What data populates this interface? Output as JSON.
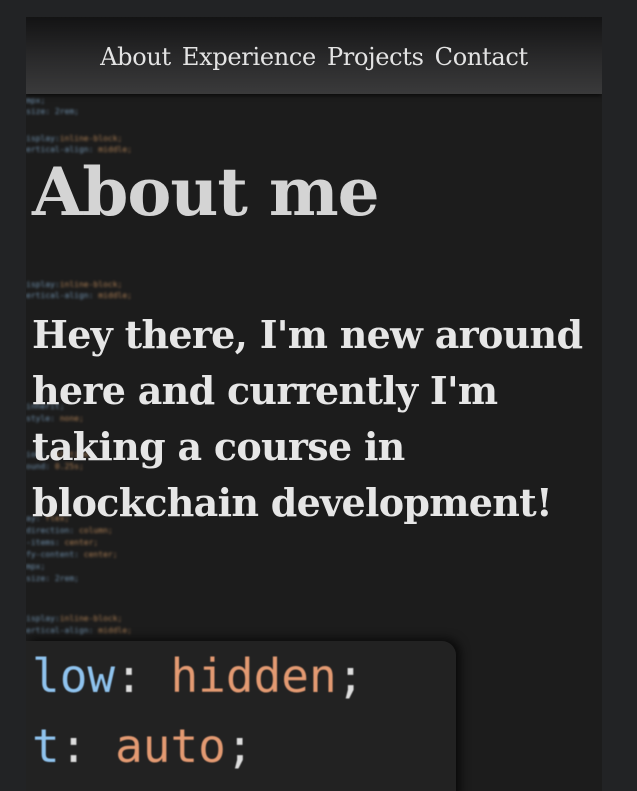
{
  "nav": {
    "items": [
      {
        "label": "About"
      },
      {
        "label": "Experience"
      },
      {
        "label": "Projects"
      },
      {
        "label": "Contact"
      }
    ]
  },
  "main": {
    "title": "About me",
    "intro": "Hey there, I'm new around here and currently I'm taking a course in blockchain development!"
  },
  "code_window": {
    "lines": [
      {
        "prop": "low",
        "punct": ": ",
        "value": "hidden",
        "end": ";"
      },
      {
        "prop": "t",
        "punct": ": ",
        "value": "auto",
        "end": ";"
      }
    ]
  },
  "colors": {
    "page_background": "#222325",
    "content_background": "#1c1c1c",
    "text": "#e6e6e6",
    "code_property": "#8fc3ee",
    "code_value": "#e39a72"
  }
}
